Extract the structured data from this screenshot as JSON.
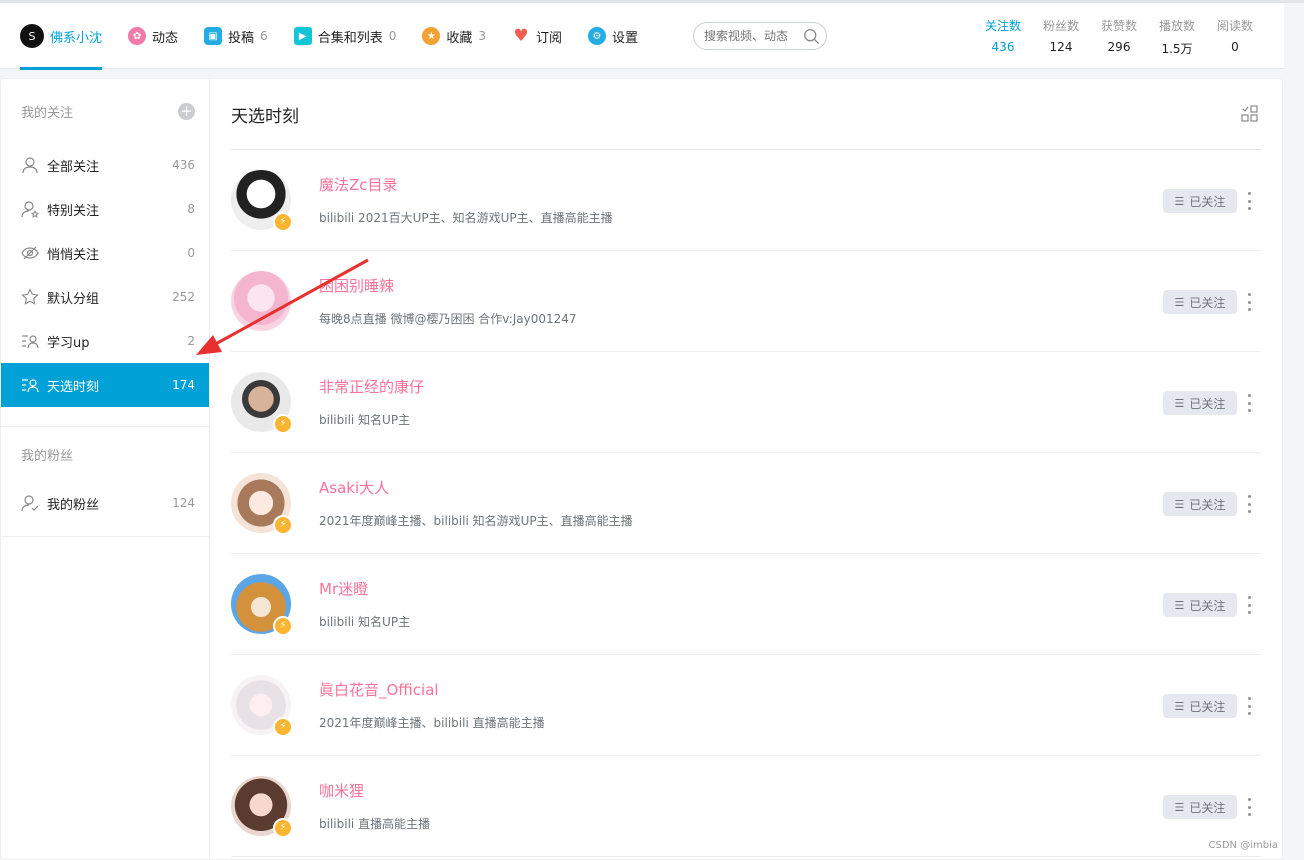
{
  "nav": {
    "user": {
      "avatar_letter": "S",
      "name": "佛系小沈"
    },
    "items": [
      {
        "label": "动态",
        "count": ""
      },
      {
        "label": "投稿",
        "count": "6"
      },
      {
        "label": "合集和列表",
        "count": "0"
      },
      {
        "label": "收藏",
        "count": "3"
      },
      {
        "label": "订阅",
        "count": ""
      },
      {
        "label": "设置",
        "count": ""
      }
    ],
    "search_placeholder": "搜索视频、动态"
  },
  "stats": [
    {
      "label": "关注数",
      "value": "436"
    },
    {
      "label": "粉丝数",
      "value": "124"
    },
    {
      "label": "获赞数",
      "value": "296"
    },
    {
      "label": "播放数",
      "value": "1.5万"
    },
    {
      "label": "阅读数",
      "value": "0"
    }
  ],
  "sidebar": {
    "following_title": "我的关注",
    "items": [
      {
        "label": "全部关注",
        "count": "436"
      },
      {
        "label": "特别关注",
        "count": "8"
      },
      {
        "label": "悄悄关注",
        "count": "0"
      },
      {
        "label": "默认分组",
        "count": "252"
      },
      {
        "label": "学习up",
        "count": "2"
      },
      {
        "label": "天选时刻",
        "count": "174"
      }
    ],
    "fans_title": "我的粉丝",
    "fans_item": {
      "label": "我的粉丝",
      "count": "124"
    }
  },
  "main": {
    "title": "天选时刻",
    "follow_label": "已关注",
    "users": [
      {
        "name": "魔法Zc目录",
        "sign": "bilibili 2021百大UP主、知名游戏UP主、直播高能主播"
      },
      {
        "name": "困困别睡辣",
        "sign": "每晚8点直播 微博@樱乃困困 合作v:Jay001247"
      },
      {
        "name": "非常正经的康仔",
        "sign": "bilibili 知名UP主"
      },
      {
        "name": "Asaki大人",
        "sign": "2021年度巅峰主播、bilibili 知名游戏UP主、直播高能主播"
      },
      {
        "name": "Mr迷瞪",
        "sign": "bilibili 知名UP主"
      },
      {
        "name": "眞白花音_Official",
        "sign": "2021年度巅峰主播、bilibili 直播高能主播"
      },
      {
        "name": "咖米狸",
        "sign": "bilibili 直播高能主播"
      }
    ]
  },
  "watermark": "CSDN @imbia",
  "colors": {
    "accent": "#00a1d6",
    "username": "#fb7299",
    "badge": "#fbb531"
  }
}
